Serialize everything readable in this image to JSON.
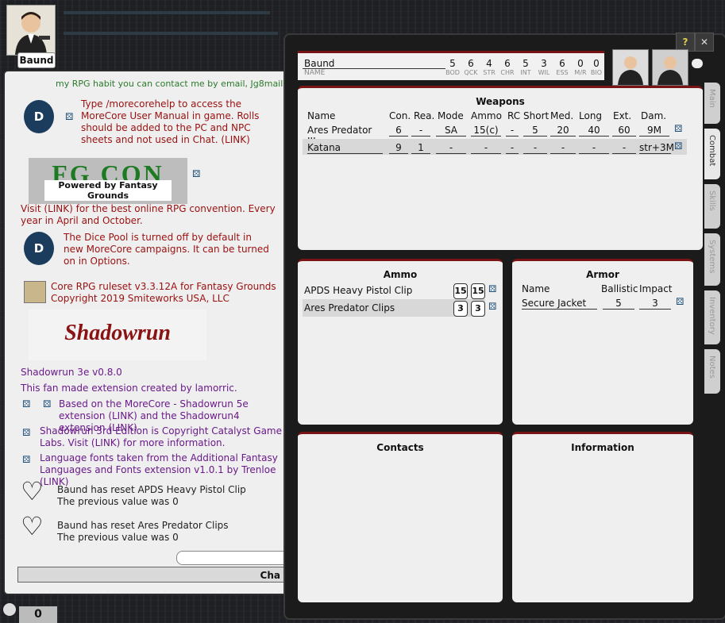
{
  "player": {
    "name": "Baund"
  },
  "chat": {
    "cut_line": "my RPG habit you can contact me by email, Jg8mail...",
    "morecore_help": "Type /morecorehelp to access the MoreCore User Manual in game.  Rolls should be added to the PC and NPC sheets and not used in Chat. (LINK)",
    "fgcon_title": "FG CON",
    "fgcon_sub": "Powered by Fantasy Grounds",
    "fgcon_visit": "Visit (LINK) for the best online RPG convention. Every year in April and October.",
    "dice_pool": "The Dice Pool is turned off by default in new MoreCore campaigns. It can be turned on in Options.",
    "ruleset": "Core RPG ruleset v3.3.12A for Fantasy Grounds\nCopyright 2019 Smiteworks USA, LLC",
    "sr_logo": "Shadowrun",
    "sr_version": "Shadowrun 3e v0.8.0",
    "fan_made": "This fan made extension created by lamorric.",
    "based_on": "Based on the MoreCore - Shadowrun 5e extension (LINK) and the Shadowrun4 extension (LINK)",
    "copyright": "Shadowrun 3rd Edition is Copyright Catalyst Game Labs. Visit (LINK) for more information.",
    "fonts": "Language fonts taken from the Additional Fantasy Languages and Fonts extension v1.0.1 by Trenloe (LINK)",
    "reset1_a": "Baund has reset APDS Heavy Pistol Clip",
    "reset1_b": "The previous value was 0",
    "reset2_a": "Baund has reset Ares Predator Clips",
    "reset2_b": "The previous value was 0",
    "chat_button": "Cha",
    "counter": "0"
  },
  "sheet": {
    "help_btn": "?",
    "close_btn": "✕",
    "name_value": "Baund",
    "name_caption": "NAME",
    "stats": [
      {
        "val": "5",
        "cap": "BOD"
      },
      {
        "val": "6",
        "cap": "QCK"
      },
      {
        "val": "4",
        "cap": "STR"
      },
      {
        "val": "6",
        "cap": "CHR"
      },
      {
        "val": "5",
        "cap": "INT"
      },
      {
        "val": "3",
        "cap": "WIL"
      },
      {
        "val": "6",
        "cap": "ESS"
      },
      {
        "val": "0",
        "cap": "M/R"
      },
      {
        "val": "0",
        "cap": "BIO"
      }
    ],
    "tabs": [
      "Main",
      "Combat",
      "Skills",
      "Systems",
      "Inventory",
      "Notes"
    ],
    "weapons": {
      "title": "Weapons",
      "headers": [
        "Name",
        "Con.",
        "Rea.",
        "Mode",
        "Ammo",
        "RC",
        "Short",
        "Med.",
        "Long",
        "Ext.",
        "Dam."
      ],
      "rows": [
        [
          "Ares Predator III",
          "6",
          "-",
          "SA",
          "15(c)",
          "-",
          "5",
          "20",
          "40",
          "60",
          "9M"
        ],
        [
          "Katana",
          "9",
          "1",
          "-",
          "-",
          "-",
          "-",
          "-",
          "-",
          "-",
          "str+3M"
        ]
      ]
    },
    "ammo": {
      "title": "Ammo",
      "rows": [
        {
          "name": "APDS Heavy Pistol Clip",
          "a": "15",
          "b": "15"
        },
        {
          "name": "Ares Predator Clips",
          "a": "3",
          "b": "3"
        }
      ]
    },
    "armor": {
      "title": "Armor",
      "headers": [
        "Name",
        "Ballistic",
        "Impact"
      ],
      "rows": [
        [
          "Secure Jacket",
          "5",
          "3"
        ]
      ]
    },
    "contacts_title": "Contacts",
    "information_title": "Information"
  },
  "colors": {
    "accent": "#7a1414",
    "link": "#1d4e7a"
  }
}
